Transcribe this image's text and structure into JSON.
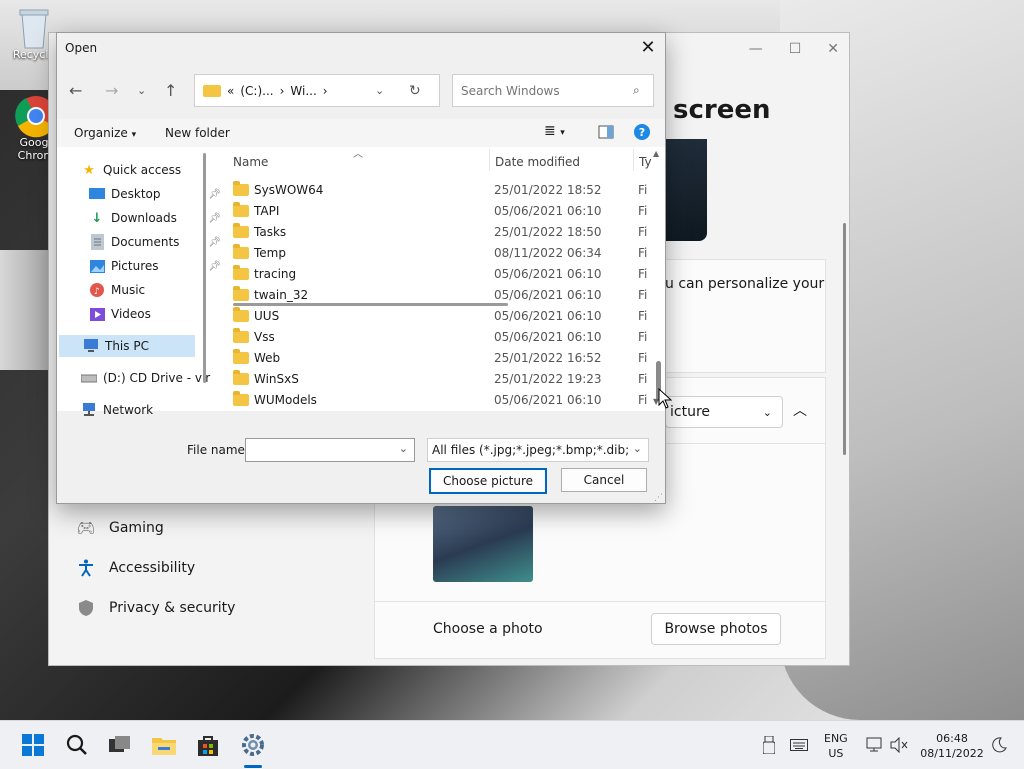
{
  "desktop": {
    "icons": [
      {
        "label": "Recycle",
        "name": "recycle-bin-icon"
      },
      {
        "label": "Goog\nChron",
        "name": "chrome-icon"
      }
    ]
  },
  "settings": {
    "heading": "screen",
    "personalize_text": "u can personalize your",
    "select_value": "icture",
    "nav": [
      {
        "label": "Gaming",
        "icon": "gamepad-icon"
      },
      {
        "label": "Accessibility",
        "icon": "accessibility-icon"
      },
      {
        "label": "Privacy & security",
        "icon": "shield-icon"
      }
    ],
    "choose_photo_label": "Choose a photo",
    "browse_button": "Browse photos"
  },
  "dialog": {
    "title": "Open",
    "close_glyph": "✕",
    "address": {
      "segments": [
        "«",
        "(C:)...",
        "›",
        "Wi...",
        "›"
      ]
    },
    "search_placeholder": "Search Windows",
    "toolbar": {
      "organize": "Organize",
      "new_folder": "New folder"
    },
    "nav_items": [
      {
        "label": "Quick access",
        "icon": "star-icon"
      },
      {
        "label": "Desktop",
        "icon": "desktop-icon",
        "pinned": true
      },
      {
        "label": "Downloads",
        "icon": "download-icon",
        "pinned": true
      },
      {
        "label": "Documents",
        "icon": "document-icon",
        "pinned": true
      },
      {
        "label": "Pictures",
        "icon": "pictures-icon",
        "pinned": true
      },
      {
        "label": "Music",
        "icon": "music-icon"
      },
      {
        "label": "Videos",
        "icon": "videos-icon"
      },
      {
        "label": "This PC",
        "icon": "pc-icon",
        "selected": true
      },
      {
        "label": "(D:) CD Drive - vir",
        "icon": "cd-drive-icon"
      },
      {
        "label": "Network",
        "icon": "network-icon"
      }
    ],
    "columns": {
      "name": "Name",
      "date": "Date modified",
      "type": "Ty"
    },
    "files": [
      {
        "name": "SysWOW64",
        "date": "25/01/2022 18:52",
        "type": "Fi"
      },
      {
        "name": "TAPI",
        "date": "05/06/2021 06:10",
        "type": "Fi"
      },
      {
        "name": "Tasks",
        "date": "25/01/2022 18:50",
        "type": "Fi"
      },
      {
        "name": "Temp",
        "date": "08/11/2022 06:34",
        "type": "Fi"
      },
      {
        "name": "tracing",
        "date": "05/06/2021 06:10",
        "type": "Fi"
      },
      {
        "name": "twain_32",
        "date": "05/06/2021 06:10",
        "type": "Fi"
      },
      {
        "name": "UUS",
        "date": "05/06/2021 06:10",
        "type": "Fi"
      },
      {
        "name": "Vss",
        "date": "05/06/2021 06:10",
        "type": "Fi"
      },
      {
        "name": "Web",
        "date": "25/01/2022 16:52",
        "type": "Fi"
      },
      {
        "name": "WinSxS",
        "date": "25/01/2022 19:23",
        "type": "Fi"
      },
      {
        "name": "WUModels",
        "date": "05/06/2021 06:10",
        "type": "Fi"
      }
    ],
    "filename_label": "File name:",
    "filename_value": "",
    "filter_value": "All files (*.jpg;*.jpeg;*.bmp;*.dib;*.png",
    "choose_button": "Choose picture",
    "cancel_button": "Cancel"
  },
  "taskbar": {
    "lang_top": "ENG",
    "lang_bottom": "US",
    "time": "06:48",
    "date": "08/11/2022"
  },
  "colors": {
    "accent": "#0067c0",
    "folder": "#f4c543",
    "selected": "#cce4f7"
  }
}
